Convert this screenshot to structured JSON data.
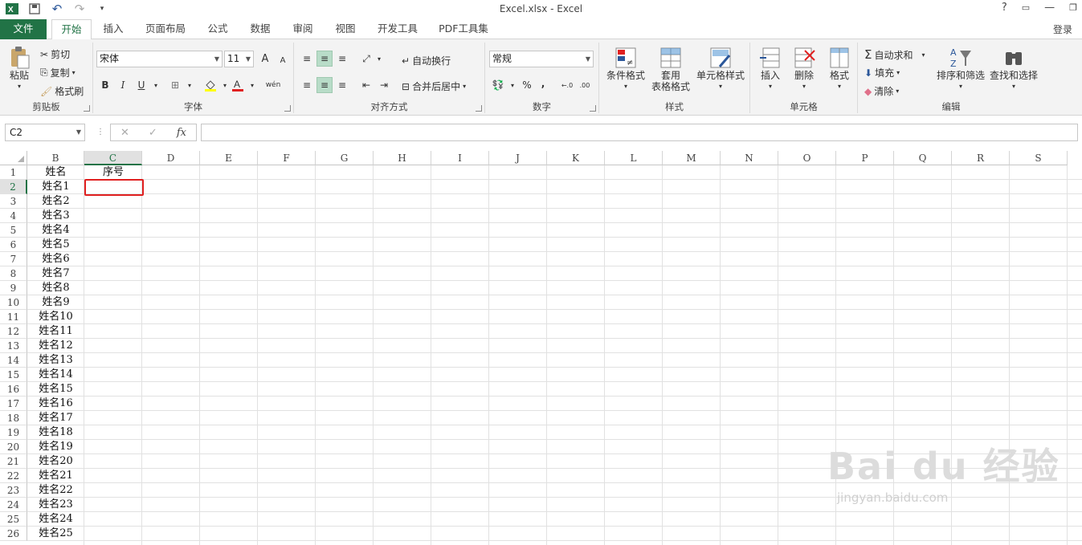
{
  "titlebar": {
    "title": "Excel.xlsx - Excel",
    "help": "?",
    "login": "登录"
  },
  "tabs": [
    "文件",
    "开始",
    "插入",
    "页面布局",
    "公式",
    "数据",
    "审阅",
    "视图",
    "开发工具",
    "PDF工具集"
  ],
  "ribbon": {
    "clipboard": {
      "paste": "粘贴",
      "cut": "剪切",
      "copy": "复制",
      "format_painter": "格式刷",
      "label": "剪贴板"
    },
    "font": {
      "name": "宋体",
      "size": "11",
      "label": "字体",
      "bold": "B",
      "italic": "I",
      "underline": "U",
      "grow": "A",
      "shrink": "A",
      "phonetic": "wén"
    },
    "alignment": {
      "wrap": "自动换行",
      "merge": "合并后居中",
      "label": "对齐方式"
    },
    "number": {
      "format": "常规",
      "label": "数字",
      "percent": "%",
      "comma": ","
    },
    "styles": {
      "conditional": "条件格式",
      "table_l1": "套用",
      "table_l2": "表格格式",
      "cell_styles": "单元格样式",
      "label": "样式"
    },
    "cells": {
      "insert": "插入",
      "delete": "删除",
      "format": "格式",
      "label": "单元格"
    },
    "editing": {
      "autosum": "自动求和",
      "fill": "填充",
      "clear": "清除",
      "sort": "排序和筛选",
      "find": "查找和选择",
      "label": "编辑"
    }
  },
  "formula_bar": {
    "name_box": "C2",
    "fx": "fx",
    "cancel": "✕",
    "enter": "✓",
    "value": ""
  },
  "grid": {
    "columns": [
      "B",
      "C",
      "D",
      "E",
      "F",
      "G",
      "H",
      "I",
      "J",
      "K",
      "L",
      "M",
      "N",
      "O",
      "P",
      "Q",
      "R",
      "S"
    ],
    "selected_column": "C",
    "selected_row": "2",
    "rows": [
      {
        "n": "1",
        "b": "姓名",
        "c": "序号"
      },
      {
        "n": "2",
        "b": "姓名1",
        "c": ""
      },
      {
        "n": "3",
        "b": "姓名2",
        "c": ""
      },
      {
        "n": "4",
        "b": "姓名3",
        "c": ""
      },
      {
        "n": "5",
        "b": "姓名4",
        "c": ""
      },
      {
        "n": "6",
        "b": "姓名5",
        "c": ""
      },
      {
        "n": "7",
        "b": "姓名6",
        "c": ""
      },
      {
        "n": "8",
        "b": "姓名7",
        "c": ""
      },
      {
        "n": "9",
        "b": "姓名8",
        "c": ""
      },
      {
        "n": "10",
        "b": "姓名9",
        "c": ""
      },
      {
        "n": "11",
        "b": "姓名10",
        "c": ""
      },
      {
        "n": "12",
        "b": "姓名11",
        "c": ""
      },
      {
        "n": "13",
        "b": "姓名12",
        "c": ""
      },
      {
        "n": "14",
        "b": "姓名13",
        "c": ""
      },
      {
        "n": "15",
        "b": "姓名14",
        "c": ""
      },
      {
        "n": "16",
        "b": "姓名15",
        "c": ""
      },
      {
        "n": "17",
        "b": "姓名16",
        "c": ""
      },
      {
        "n": "18",
        "b": "姓名17",
        "c": ""
      },
      {
        "n": "19",
        "b": "姓名18",
        "c": ""
      },
      {
        "n": "20",
        "b": "姓名19",
        "c": ""
      },
      {
        "n": "21",
        "b": "姓名20",
        "c": ""
      },
      {
        "n": "22",
        "b": "姓名21",
        "c": ""
      },
      {
        "n": "23",
        "b": "姓名22",
        "c": ""
      },
      {
        "n": "24",
        "b": "姓名23",
        "c": ""
      },
      {
        "n": "25",
        "b": "姓名24",
        "c": ""
      },
      {
        "n": "26",
        "b": "姓名25",
        "c": ""
      }
    ]
  },
  "watermark": {
    "brand": "Bai du 经验",
    "url": "jingyan.baidu.com"
  },
  "colors": {
    "excel_green": "#217346",
    "highlight": "#e02020"
  }
}
